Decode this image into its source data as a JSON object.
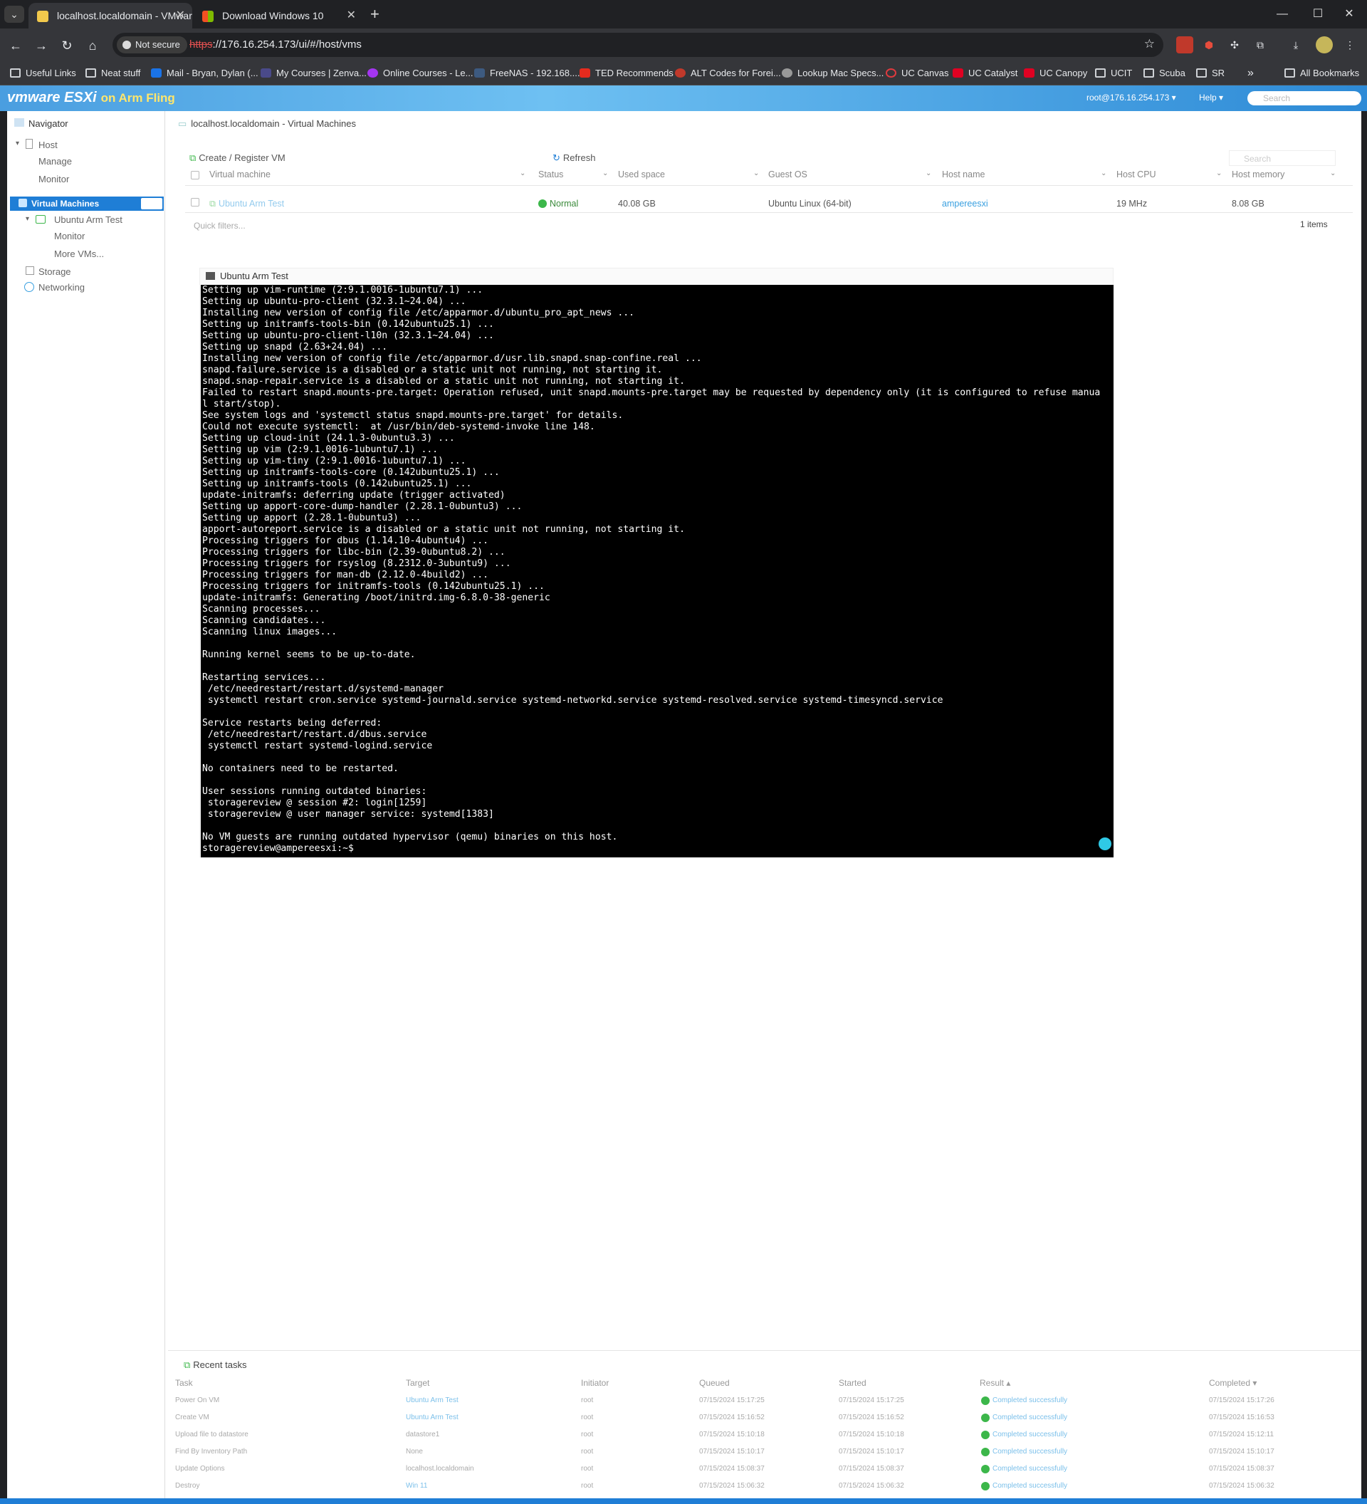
{
  "browser": {
    "tabs": [
      {
        "title": "localhost.localdomain - VMware"
      },
      {
        "title": "Download Windows 10"
      }
    ],
    "security": "Not secure",
    "url_scheme": "https",
    "url_rest": "://176.16.254.173/ui/#/host/vms",
    "bookmarks": [
      "Useful Links",
      "Neat stuff",
      "Mail - Bryan, Dylan (...",
      "My Courses | Zenva...",
      "Online Courses - Le...",
      "FreeNAS - 192.168....",
      "TED Recommends",
      "ALT Codes for Forei...",
      "Lookup Mac Specs...",
      "UC Canvas",
      "UC Catalyst",
      "UC Canopy",
      "UCIT",
      "Scuba",
      "SR"
    ],
    "all_bookmarks": "All Bookmarks"
  },
  "header": {
    "brand": "vmware ESXi",
    "fling": "on Arm Fling",
    "user": "root@176.16.254.173 ▾",
    "help": "Help ▾",
    "search_placeholder": "Search"
  },
  "navigator": {
    "title": "Navigator",
    "host": "Host",
    "manage": "Manage",
    "monitor": "Monitor",
    "vms": "Virtual Machines",
    "vm_name": "Ubuntu Arm Test",
    "vm_monitor": "Monitor",
    "more_vms": "More VMs...",
    "storage": "Storage",
    "networking": "Networking"
  },
  "breadcrumb": "localhost.localdomain - Virtual Machines",
  "actions": {
    "create": "Create / Register VM",
    "refresh": "Refresh",
    "search_placeholder": "Search"
  },
  "vm_table": {
    "columns": [
      "Virtual machine",
      "Status",
      "Used space",
      "Guest OS",
      "Host name",
      "Host CPU",
      "Host memory"
    ],
    "row": {
      "name": "Ubuntu Arm Test",
      "status": "Normal",
      "used_space": "40.08 GB",
      "guest_os": "Ubuntu Linux (64-bit)",
      "host_name": "ampereesxi",
      "host_cpu": "19 MHz",
      "host_memory": "8.08 GB"
    },
    "quick_filters": "Quick filters...",
    "count": "1 items"
  },
  "console": {
    "title": "Ubuntu Arm Test",
    "lines": [
      "Setting up vim-runtime (2:9.1.0016-1ubuntu7.1) ...",
      "Setting up ubuntu-pro-client (32.3.1~24.04) ...",
      "Installing new version of config file /etc/apparmor.d/ubuntu_pro_apt_news ...",
      "Setting up initramfs-tools-bin (0.142ubuntu25.1) ...",
      "Setting up ubuntu-pro-client-l10n (32.3.1~24.04) ...",
      "Setting up snapd (2.63+24.04) ...",
      "Installing new version of config file /etc/apparmor.d/usr.lib.snapd.snap-confine.real ...",
      "snapd.failure.service is a disabled or a static unit not running, not starting it.",
      "snapd.snap-repair.service is a disabled or a static unit not running, not starting it.",
      "Failed to restart snapd.mounts-pre.target: Operation refused, unit snapd.mounts-pre.target may be requested by dependency only (it is configured to refuse manua",
      "l start/stop).",
      "See system logs and 'systemctl status snapd.mounts-pre.target' for details.",
      "Could not execute systemctl:  at /usr/bin/deb-systemd-invoke line 148.",
      "Setting up cloud-init (24.1.3-0ubuntu3.3) ...",
      "Setting up vim (2:9.1.0016-1ubuntu7.1) ...",
      "Setting up vim-tiny (2:9.1.0016-1ubuntu7.1) ...",
      "Setting up initramfs-tools-core (0.142ubuntu25.1) ...",
      "Setting up initramfs-tools (0.142ubuntu25.1) ...",
      "update-initramfs: deferring update (trigger activated)",
      "Setting up apport-core-dump-handler (2.28.1-0ubuntu3) ...",
      "Setting up apport (2.28.1-0ubuntu3) ...",
      "apport-autoreport.service is a disabled or a static unit not running, not starting it.",
      "Processing triggers for dbus (1.14.10-4ubuntu4) ...",
      "Processing triggers for libc-bin (2.39-0ubuntu8.2) ...",
      "Processing triggers for rsyslog (8.2312.0-3ubuntu9) ...",
      "Processing triggers for man-db (2.12.0-4build2) ...",
      "Processing triggers for initramfs-tools (0.142ubuntu25.1) ...",
      "update-initramfs: Generating /boot/initrd.img-6.8.0-38-generic",
      "Scanning processes...",
      "Scanning candidates...",
      "Scanning linux images...",
      "",
      "Running kernel seems to be up-to-date.",
      "",
      "Restarting services...",
      " /etc/needrestart/restart.d/systemd-manager",
      " systemctl restart cron.service systemd-journald.service systemd-networkd.service systemd-resolved.service systemd-timesyncd.service",
      "",
      "Service restarts being deferred:",
      " /etc/needrestart/restart.d/dbus.service",
      " systemctl restart systemd-logind.service",
      "",
      "No containers need to be restarted.",
      "",
      "User sessions running outdated binaries:",
      " storagereview @ session #2: login[1259]",
      " storagereview @ user manager service: systemd[1383]",
      "",
      "No VM guests are running outdated hypervisor (qemu) binaries on this host.",
      "storagereview@ampereesxi:~$"
    ]
  },
  "recent_tasks": {
    "title": "Recent tasks",
    "columns": [
      "Task",
      "Target",
      "Initiator",
      "Queued",
      "Started",
      "Result ▴",
      "Completed ▾"
    ],
    "rows": [
      {
        "task": "Power On VM",
        "target": "Ubuntu Arm Test",
        "initiator": "root",
        "queued": "07/15/2024 15:17:25",
        "started": "07/15/2024 15:17:25",
        "result": "Completed successfully",
        "completed": "07/15/2024 15:17:26"
      },
      {
        "task": "Create VM",
        "target": "Ubuntu Arm Test",
        "initiator": "root",
        "queued": "07/15/2024 15:16:52",
        "started": "07/15/2024 15:16:52",
        "result": "Completed successfully",
        "completed": "07/15/2024 15:16:53"
      },
      {
        "task": "Upload file to datastore",
        "target": "datastore1",
        "initiator": "root",
        "queued": "07/15/2024 15:10:18",
        "started": "07/15/2024 15:10:18",
        "result": "Completed successfully",
        "completed": "07/15/2024 15:12:11"
      },
      {
        "task": "Find By Inventory Path",
        "target": "None",
        "initiator": "root",
        "queued": "07/15/2024 15:10:17",
        "started": "07/15/2024 15:10:17",
        "result": "Completed successfully",
        "completed": "07/15/2024 15:10:17"
      },
      {
        "task": "Update Options",
        "target": "localhost.localdomain",
        "initiator": "root",
        "queued": "07/15/2024 15:08:37",
        "started": "07/15/2024 15:08:37",
        "result": "Completed successfully",
        "completed": "07/15/2024 15:08:37"
      },
      {
        "task": "Destroy",
        "target": "Win 11",
        "initiator": "root",
        "queued": "07/15/2024 15:06:32",
        "started": "07/15/2024 15:06:32",
        "result": "Completed successfully",
        "completed": "07/15/2024 15:06:32"
      }
    ]
  },
  "colors": {
    "accent": "#1f7ed6",
    "link": "#3aa0e0",
    "ok": "#3cb74a",
    "terminal_bg": "#000000"
  }
}
